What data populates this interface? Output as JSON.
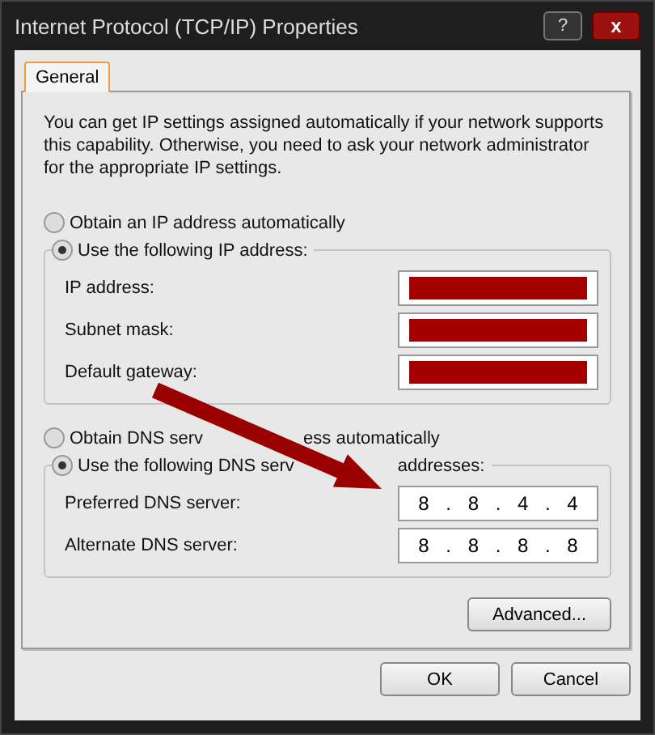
{
  "window": {
    "title": "Internet Protocol (TCP/IP) Properties",
    "help_button": "?",
    "close_button": "x"
  },
  "tabs": [
    {
      "label": "General",
      "selected": true
    }
  ],
  "description": "You can get IP settings assigned automatically if your network supports this capability. Otherwise, you need to ask your network administrator for the appropriate IP settings.",
  "ip_options": [
    {
      "label": "Obtain an IP address automatically",
      "selected": false
    },
    {
      "label": "Use the following IP address:",
      "selected": true
    }
  ],
  "ip_fields": [
    {
      "label": "IP address:",
      "redacted": true
    },
    {
      "label": "Subnet mask:",
      "redacted": true
    },
    {
      "label": "Default gateway:",
      "redacted": true
    }
  ],
  "dns_options": [
    {
      "label_parts": [
        "Obtain DNS serv",
        "ess automatically"
      ],
      "selected": false
    },
    {
      "label_parts": [
        "Use the following DNS serv",
        "addresses:"
      ],
      "selected": true
    }
  ],
  "dns_fields": [
    {
      "label": "Preferred DNS server:",
      "value": "8 . 8 . 4 . 4"
    },
    {
      "label": "Alternate DNS server:",
      "value": "8 . 8 . 8 . 8"
    }
  ],
  "advanced_button": "Advanced...",
  "buttons": [
    {
      "label": "OK"
    },
    {
      "label": "Cancel"
    }
  ]
}
